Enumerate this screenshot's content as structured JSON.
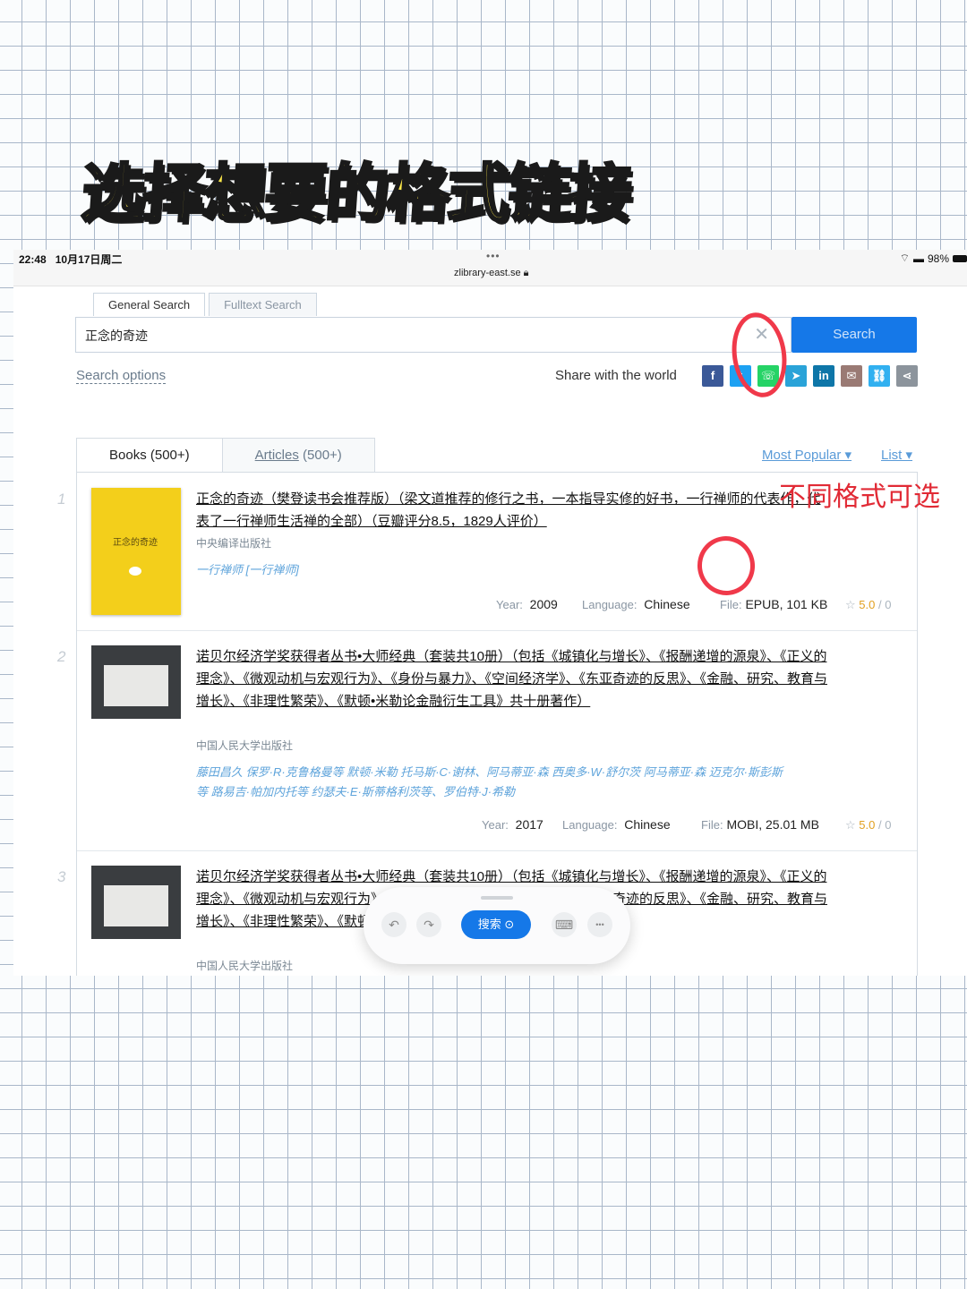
{
  "headline": "选择想要的格式链接",
  "annotation_note": "不同格式可选",
  "statusbar": {
    "time": "22:48",
    "date": "10月17日周二",
    "dots": "•••",
    "url": "zlibrary-east.se",
    "battery": "98%"
  },
  "search": {
    "tab_general": "General Search",
    "tab_fulltext": "Fulltext Search",
    "query": "正念的奇迹",
    "clear": "✕",
    "button": "Search",
    "options": "Search options",
    "share_label": "Share with the world"
  },
  "results_tabs": {
    "books": "Books",
    "books_count": "(500+)",
    "articles": "Articles",
    "articles_count": "(500+)",
    "sort": "Most Popular ▾",
    "view": "List ▾"
  },
  "labels": {
    "year": "Year:",
    "language": "Language:",
    "file": "File:"
  },
  "results": [
    {
      "num": "1",
      "title": "正念的奇迹（樊登读书会推荐版）（梁文道推荐的修行之书，一本指导实修的好书，一行禅师的代表作，代表了一行禅师生活禅的全部）（豆瓣评分8.5，1829人评价）",
      "publisher": "中央编译出版社",
      "authors": "一行禅师 [一行禅师]",
      "year": "2009",
      "language": "Chinese",
      "file": "EPUB, 101 KB",
      "rating": "5.0",
      "quality": "0",
      "cover_title": "正念的奇迹"
    },
    {
      "num": "2",
      "title": "诺贝尔经济学奖获得者丛书•大师经典（套装共10册）（包括《城镇化与增长》、《报酬递增的源泉》、《正义的理念》、《微观动机与宏观行为》、《身份与暴力》、《空间经济学》、《东亚奇迹的反思》、《金融、研究、教育与增长》、《非理性繁荣》、《默顿•米勒论金融衍生工具》共十册著作）",
      "publisher": "中国人民大学出版社",
      "authors": "藤田昌久 保罗·R·克鲁格曼等 默顿·米勒 托马斯·C·谢林、阿马蒂亚·森 西奥多·W·舒尔茨 阿马蒂亚·森 迈克尔·斯彭斯等 路易吉·帕加内托等 约瑟夫·E·斯蒂格利茨等、罗伯特·J·希勒",
      "year": "2017",
      "language": "Chinese",
      "file": "MOBI, 25.01 MB",
      "rating": "5.0",
      "quality": "0"
    },
    {
      "num": "3",
      "title": "诺贝尔经济学奖获得者丛书•大师经典（套装共10册）（包括《城镇化与增长》、《报酬递增的源泉》、《正义的理念》、《微观动机与宏观行为》、《身份与暴力》、《空间经济学》、《东亚奇迹的反思》、《金融、研究、教育与增长》、《非理性繁荣》、《默顿•米勒论金融衍生工具》共十册著作）",
      "publisher": "中国人民大学出版社"
    }
  ],
  "toolbar": {
    "undo": "↶",
    "redo": "↷",
    "search": "搜索 ⊙",
    "keyboard": "⌨",
    "more": "•••"
  },
  "icons": {
    "share": [
      "facebook-icon",
      "twitter-icon",
      "whatsapp-icon",
      "telegram-icon",
      "linkedin-icon",
      "email-icon",
      "link-icon",
      "share-icon"
    ]
  }
}
